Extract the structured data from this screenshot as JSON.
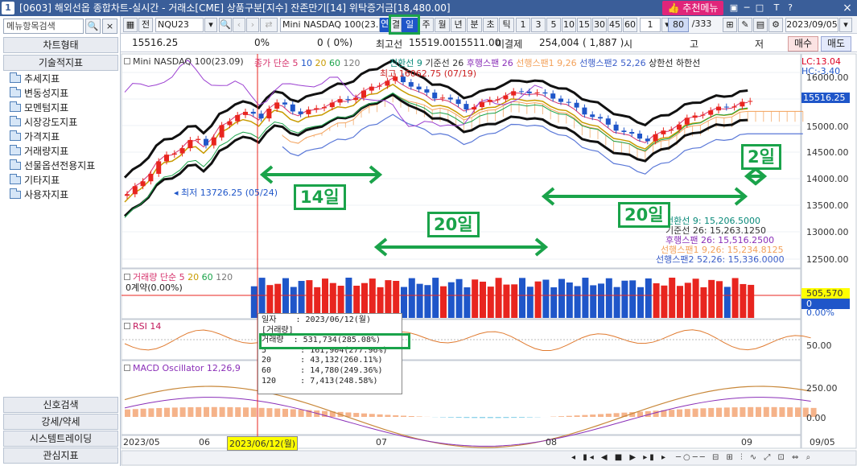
{
  "window": {
    "num": "1",
    "title": "[0603] 해외선옵 종합차트-실시간 - 거래소[CME] 상품구분[지수] 잔존만기[14] 위탁증거금[18,480.00]",
    "recommend": "추천메뉴",
    "controls": [
      "▣",
      "─",
      "□",
      "T",
      "?",
      "×"
    ]
  },
  "sidebar": {
    "search_placeholder": "메뉴항목검색",
    "chart_type": "차트형태",
    "tech_index": "기술적지표",
    "items": [
      "추세지표",
      "변동성지표",
      "모멘텀지표",
      "시장강도지표",
      "가격지표",
      "거래량지표",
      "선물옵션전용지표",
      "기타지표",
      "사용자지표"
    ],
    "bottom": [
      "신호검색",
      "강세/약세",
      "시스템트레이딩",
      "관심지표"
    ]
  },
  "toolbar": {
    "cfg": "전",
    "code": "NQU23",
    "name": "Mini NASDAQ 100(23.09)",
    "periods": [
      "연",
      "결",
      "일",
      "주",
      "월",
      "년",
      "분",
      "초",
      "틱"
    ],
    "nums": [
      "1",
      "3",
      "5",
      "10",
      "15",
      "30",
      "45",
      "60"
    ],
    "count": "1",
    "page": "80",
    "total": "/333",
    "date": "2023/09/05"
  },
  "info": {
    "price": "15516.25",
    "pct1": "0%",
    "vol0": "0",
    "pct2": "0%",
    "hilo_lbl": "최고선",
    "v1": "15519.00",
    "v2": "15511.00",
    "mij": "미결제",
    "oi": "254,004",
    "oid": "( 1,887 )",
    "s": "시",
    "g": "고",
    "j": "저",
    "buy": "매수",
    "sell": "매도"
  },
  "chart_text": {
    "price_title": "Mini NASDAQ 100(23.09)",
    "ma_legend": "종가 단순",
    "ma_periods": [
      "5",
      "10",
      "20",
      "60",
      "120"
    ],
    "ichimoku_legend": [
      "전환선 9",
      "기준선 26",
      "후행스팬 26",
      "선행스팬1 9,26",
      "선행스팬2 52,26",
      "상한선",
      "하한선"
    ],
    "high": "최고 16062.75 (07/19)",
    "low": "최저 13726.25 (05/24)",
    "lc": "LC:13.04",
    "hc": "HC:-3.40",
    "price_ticks": [
      "16000.00",
      "15500.00",
      "15000.00",
      "14500.00",
      "14000.00",
      "13500.00",
      "13000.00",
      "12500.00"
    ],
    "price_badge": "15516.25",
    "ichimoku_values": [
      "전환선 9: 15,206.5000",
      "기준선 26: 15,263.1250",
      "후행스팬 26: 15,516.2500",
      "선행스팬1 9,26: 15,234.8125",
      "선행스팬2 52,26: 15,336.0000"
    ],
    "vol_title": "거래량 단순",
    "vol_periods": [
      "5",
      "20",
      "60",
      "120"
    ],
    "vol_sub": "0계약(0.00%)",
    "vol_badge": "505,570",
    "vol_badge2": "0",
    "vol_pct": "0.00%",
    "rsi_title": "RSI 14",
    "rsi_tick": "50.00",
    "macd_title": "MACD Oscillator 12,26,9",
    "macd_ticks": [
      "250.00",
      "0.00"
    ],
    "x_ticks": [
      "2023/05",
      "06",
      "2023/06/12(월)",
      "07",
      "08",
      "09",
      "09/05"
    ]
  },
  "tooltip": {
    "lines": [
      "일자    : 2023/06/12(월)",
      "[거래량]",
      "거래량  : 531,734(285.08%)",
      "5       : 161,904(277.96%)",
      "20      : 43,132(260.11%)",
      "60      : 14,780(249.36%)",
      "120     : 7,413(248.58%)"
    ]
  },
  "annotations": {
    "a14": "14일",
    "a20a": "20일",
    "a20b": "20일",
    "a2": "2일"
  },
  "colors": {
    "up": "#e8251f",
    "down": "#1f56c9",
    "green": "#1aa34a",
    "ichimoku": "#f3a15a",
    "bollinger": "#111111",
    "rsi": "#e07a2f",
    "macd_line": "#c8883a"
  }
}
